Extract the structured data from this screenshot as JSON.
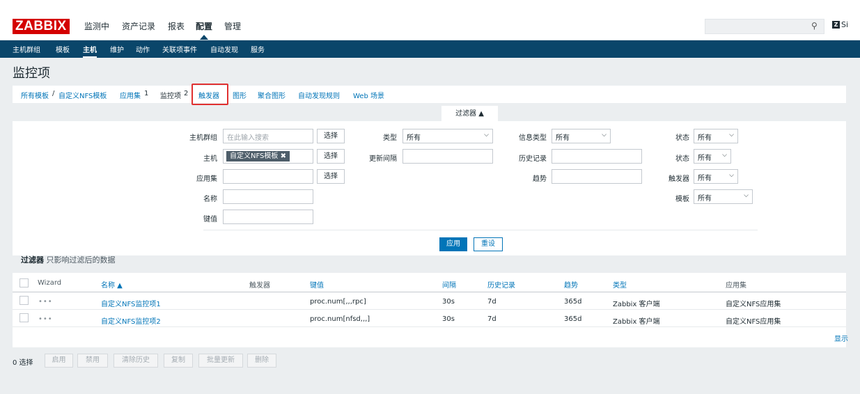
{
  "topbar": {
    "logo": "ZABBIX",
    "nav": [
      "监测中",
      "资产记录",
      "报表",
      "配置",
      "管理"
    ],
    "active_nav": "配置",
    "user_text": "Si"
  },
  "subnav": {
    "items": [
      "主机群组",
      "模板",
      "主机",
      "维护",
      "动作",
      "关联项事件",
      "自动发现",
      "服务"
    ],
    "active": "主机"
  },
  "page_title": "监控项",
  "tabs": {
    "breadcrumb_root": "所有模板",
    "separator": "/",
    "template": "自定义NFS模板",
    "app_set": "应用集",
    "app_set_count": "1",
    "items": "监控项",
    "items_count": "2",
    "triggers": "触发器",
    "graphs": "图形",
    "screens": "聚合图形",
    "discovery": "自动发现规则",
    "web": "Web 场景"
  },
  "filter": {
    "tab_label": "过滤器 ▲",
    "host_group_label": "主机群组",
    "host_group_placeholder": "在此输入搜索",
    "select_btn": "选择",
    "host_label": "主机",
    "host_tag": "自定义NFS模板 ✖",
    "app_label": "应用集",
    "name_label": "名称",
    "key_label": "键值",
    "type_label": "类型",
    "type_value": "所有",
    "interval_label": "更新间隔",
    "info_type_label": "信息类型",
    "info_type_value": "所有",
    "history_label": "历史记录",
    "trends_label": "趋势",
    "state_label": "状态",
    "state_value": "所有",
    "status_label": "状态",
    "status_value": "所有",
    "triggers_label": "触发器",
    "triggers_value": "所有",
    "template_label": "模板",
    "template_value": "所有",
    "apply": "应用",
    "reset": "重设",
    "note_bold": "过滤器",
    "note_text": " 只影响过滤后的数据"
  },
  "table": {
    "headers": {
      "wizard": "Wizard",
      "name": "名称 ▲",
      "triggers": "触发器",
      "key": "键值",
      "interval": "间隔",
      "history": "历史记录",
      "trends": "趋势",
      "type": "类型",
      "apps": "应用集"
    },
    "rows": [
      {
        "wizard": "•••",
        "name": "自定义NFS监控项1",
        "key": "proc.num[,,,rpc]",
        "interval": "30s",
        "history": "7d",
        "trends": "365d",
        "type": "Zabbix 客户端",
        "apps": "自定义NFS应用集"
      },
      {
        "wizard": "•••",
        "name": "自定义NFS监控项2",
        "key": "proc.num[nfsd,,,]",
        "interval": "30s",
        "history": "7d",
        "trends": "365d",
        "type": "Zabbix 客户端",
        "apps": "自定义NFS应用集"
      }
    ],
    "display_label": "显示"
  },
  "actions": {
    "selected": "0 选择",
    "buttons": [
      "启用",
      "禁用",
      "清除历史",
      "复制",
      "批量更新",
      "删除"
    ]
  }
}
